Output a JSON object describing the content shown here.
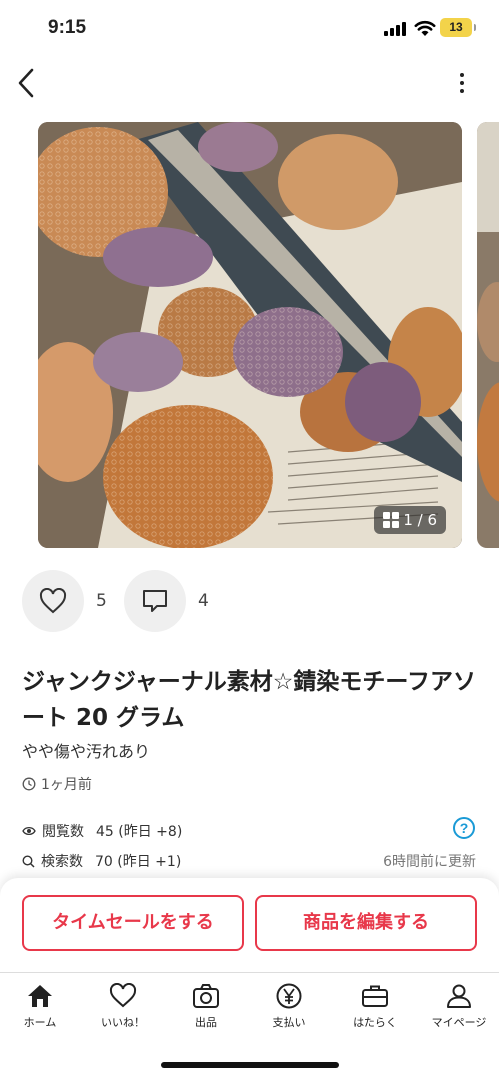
{
  "status_bar": {
    "time": "9:15",
    "battery": "13"
  },
  "header": {
    "back_icon": "chevron-left-icon",
    "more_icon": "vertical-dots-icon"
  },
  "carousel": {
    "page_counter": "1 / 6",
    "current_page": 1,
    "total_pages": 6
  },
  "reactions": {
    "likes": "5",
    "comments": "4"
  },
  "item": {
    "title": "ジャンクジャーナル素材☆錆染モチーフアソート 20 グラム",
    "condition": "やや傷や汚れあり",
    "posted": "1ヶ月前"
  },
  "stats": {
    "views_label": "閲覧数",
    "views_value": "45 (昨日 +8)",
    "search_label": "検索数",
    "search_value": "70 (昨日 +1)",
    "help": "?",
    "updated": "6時間前に更新"
  },
  "actions": {
    "time_sale": "タイムセールをする",
    "edit_item": "商品を編集する"
  },
  "tabs": [
    {
      "label": "ホーム",
      "icon": "home-icon"
    },
    {
      "label": "いいね！",
      "icon": "heart-icon"
    },
    {
      "label": "出品",
      "icon": "camera-icon"
    },
    {
      "label": "支払い",
      "icon": "yen-icon"
    },
    {
      "label": "はたらく",
      "icon": "briefcase-icon"
    },
    {
      "label": "マイページ",
      "icon": "person-icon"
    }
  ],
  "colors": {
    "accent": "#e8384a",
    "help_blue": "#1a9ad6",
    "battery": "#f3d34a"
  }
}
